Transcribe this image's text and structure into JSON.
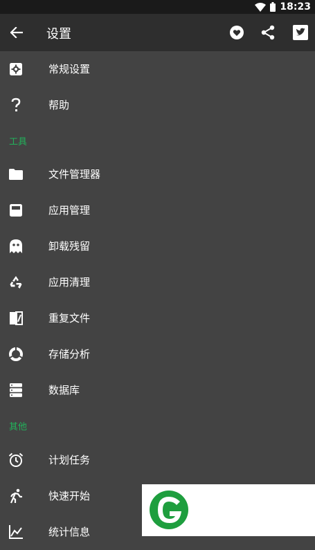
{
  "status_bar": {
    "time": "18:23"
  },
  "app_bar": {
    "title": "设置"
  },
  "menu": {
    "general": "常规设置",
    "help": "帮助",
    "tools_header": "工具",
    "tools": [
      {
        "label": "文件管理器",
        "icon": "folder-icon"
      },
      {
        "label": "应用管理",
        "icon": "app-manager-icon"
      },
      {
        "label": "卸载残留",
        "icon": "ghost-icon"
      },
      {
        "label": "应用清理",
        "icon": "recycle-icon"
      },
      {
        "label": "重复文件",
        "icon": "duplicate-icon"
      },
      {
        "label": "存储分析",
        "icon": "storage-analysis-icon"
      },
      {
        "label": "数据库",
        "icon": "database-icon"
      }
    ],
    "other_header": "其他",
    "other": [
      {
        "label": "计划任务",
        "icon": "alarm-icon"
      },
      {
        "label": "快速开始",
        "icon": "run-icon"
      },
      {
        "label": "统计信息",
        "icon": "stats-icon"
      }
    ]
  },
  "colors": {
    "background": "#434343",
    "app_bar": "#2e2e2e",
    "status_bar": "#1a1a1a",
    "accent": "#22b25b"
  }
}
